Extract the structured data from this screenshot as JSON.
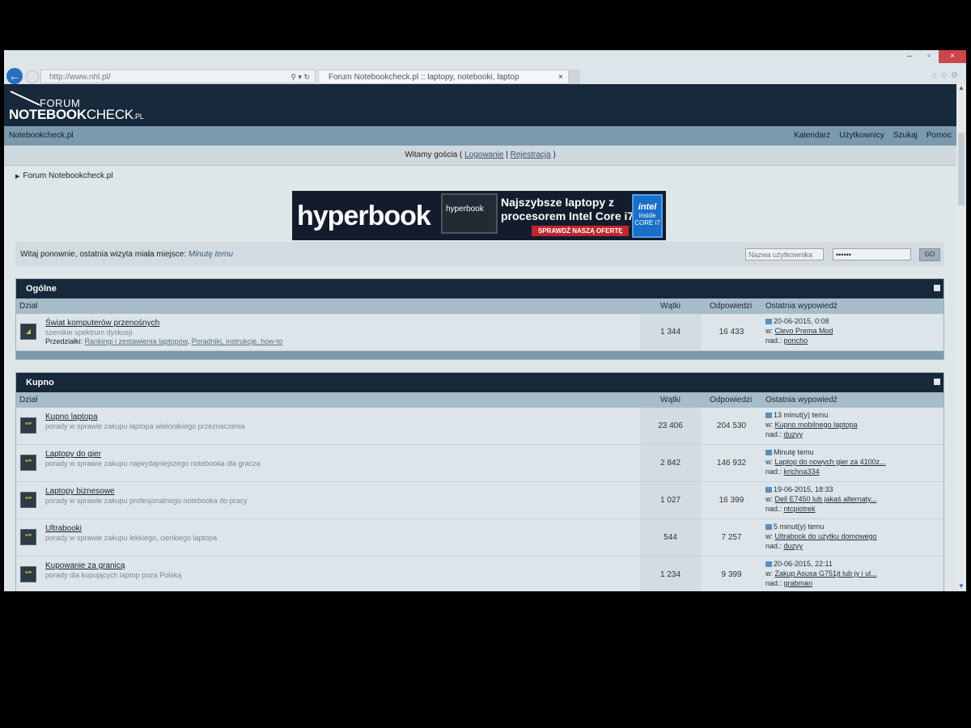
{
  "browser": {
    "url": "http://www.nhl.pl/",
    "tab_title": "Forum Notebookcheck.pl :: laptopy, notebooki, laptop",
    "tab_close": "×",
    "win_min": "–",
    "win_max": "▫",
    "win_close": "×"
  },
  "logo": {
    "forum": "FORUM",
    "name_bold": "NOTEBOOK",
    "name_thin": "CHECK",
    "pl": ".PL"
  },
  "navbar": {
    "home": "Notebookcheck.pl",
    "links": [
      "Kalendarz",
      "Użytkownicy",
      "Szukaj",
      "Pomoc"
    ]
  },
  "welcome": {
    "text": "Witamy gościa (",
    "login": "Logowanie",
    "sep": "|",
    "register": "Rejestracja",
    "close": ")"
  },
  "breadcrumb": "Forum Notebookcheck.pl",
  "ad": {
    "brand": "hyperbook",
    "laptop_label": "hyperbook",
    "tagline1": "Najszybsze laptopy z",
    "tagline2": "procesorem Intel Core i7",
    "cta": "SPRAWDŹ NASZĄ OFERTĘ",
    "intel_logo": "intel",
    "intel_inside": "inside",
    "intel_core": "CORE i7"
  },
  "loginbar": {
    "message": "Witaj ponownie, ostatnia wizyta miała miejsce:",
    "last_visit": "Minutę temu",
    "username_placeholder": "Nazwa użytkownika",
    "password_value": "••••••",
    "go": "GO"
  },
  "columns": {
    "forum": "Dział",
    "threads": "Wątki",
    "replies": "Odpowiedzi",
    "last_post": "Ostatnia wypowiedź"
  },
  "categories": [
    {
      "title": "Ogólne",
      "forums": [
        {
          "title": "Świat komputerów przenośnych",
          "desc": "szerokie spektrum dyskusji",
          "sub_label": "Przedziałki:",
          "sub1": "Rankingi i zestawienia laptopów",
          "sub2": "Poradniki, instrukcje, how-to",
          "threads": "1 344",
          "replies": "16 433",
          "last_time": "20-06-2015, 0:08",
          "last_in": "Clevo Prema Mod",
          "last_by": "poncho"
        }
      ]
    },
    {
      "title": "Kupno",
      "forums": [
        {
          "title": "Kupno laptopa",
          "desc": "porady w sprawie zakupu laptopa wielorakiego przeznaczenia",
          "threads": "23 406",
          "replies": "204 530",
          "last_time": "13 minut(y) temu",
          "last_in": "Kupno mobilnego laptopa",
          "last_by": "duzyy"
        },
        {
          "title": "Laptopy do gier",
          "desc": "porady w sprawie zakupu najwydajniejszego notebooka dla gracza",
          "threads": "2 842",
          "replies": "146 932",
          "last_time": "Minutę temu",
          "last_in": "Laptop do nowych gier za 4100z...",
          "last_by": "krichna334"
        },
        {
          "title": "Laptopy biznesowe",
          "desc": "porady w sprawie zakupu profesjonalnego notebooka do pracy",
          "threads": "1 027",
          "replies": "16 399",
          "last_time": "19-06-2015, 18:33",
          "last_in": "Dell E7450 lub jakaś alternaty...",
          "last_by": "ntcpiotrek"
        },
        {
          "title": "Ultrabooki",
          "desc": "porady w sprawie zakupu lekkiego, cienkiego laptopa",
          "threads": "544",
          "replies": "7 257",
          "last_time": "5 minut(y) temu",
          "last_in": "Ultrabook do użytku domowego",
          "last_by": "duzyy"
        },
        {
          "title": "Kupowanie za granicą",
          "desc": "porady dla kupujących laptop poza Polską",
          "threads": "1 234",
          "replies": "9 399",
          "last_time": "20-06-2015, 22:11",
          "last_in": "Zakup Asusa G751jt lub jy i ul...",
          "last_by": "grabman"
        }
      ]
    }
  ],
  "labels": {
    "in": "w:",
    "by": "nad.:"
  },
  "colors": {
    "header_dark": "#16283a",
    "navbar": "#7a9aac",
    "column_header": "#a6bcc9",
    "back_button": "#2a6fbf",
    "close_button": "#c9464a"
  },
  "icons": [
    "back-arrow-icon",
    "forward-arrow-icon",
    "search-icon",
    "refresh-icon",
    "home-icon",
    "star-icon",
    "gear-icon",
    "collapse-icon",
    "forum-icon",
    "post-icon"
  ]
}
